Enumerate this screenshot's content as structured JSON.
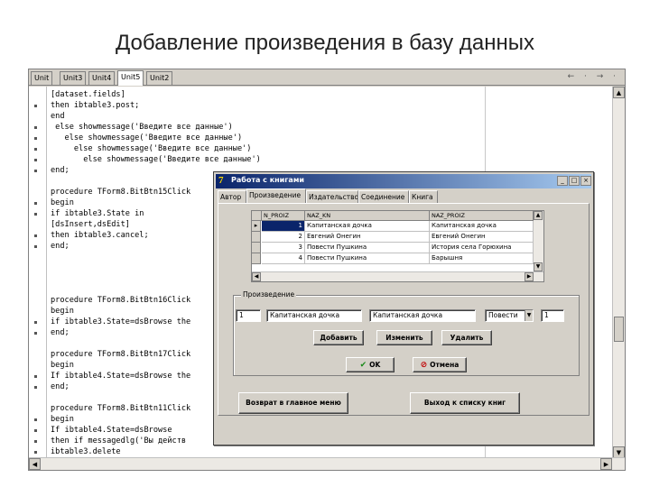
{
  "slide_title": "Добавление произведения в базу данных",
  "editor": {
    "tabs": [
      "Unit",
      "Unit3",
      "Unit4",
      "Unit5",
      "Unit2"
    ],
    "active_tab": 3,
    "nav_arrows": "← · → ·",
    "code_lines": [
      {
        "text": "[dataset.fields]",
        "dot": false
      },
      {
        "text": "then ibtable3.post;",
        "dot": true
      },
      {
        "text": "end",
        "dot": false
      },
      {
        "text": " else showmessage('Введите все данные')",
        "dot": true
      },
      {
        "text": "   else showmessage('Введите все данные')",
        "dot": true
      },
      {
        "text": "     else showmessage('Введите все данные')",
        "dot": true
      },
      {
        "text": "       else showmessage('Введите все данные')",
        "dot": true
      },
      {
        "text": "end;",
        "dot": true
      },
      {
        "text": "",
        "dot": false
      },
      {
        "text": "procedure TForm8.BitBtn15Click",
        "dot": false
      },
      {
        "text": "begin",
        "dot": true
      },
      {
        "text": "if ibtable3.State in",
        "dot": true
      },
      {
        "text": "[dsInsert,dsEdit]",
        "dot": false
      },
      {
        "text": "then ibtable3.cancel;",
        "dot": true
      },
      {
        "text": "end;",
        "dot": true
      },
      {
        "text": "",
        "dot": false
      },
      {
        "text": "",
        "dot": false
      },
      {
        "text": "",
        "dot": false
      },
      {
        "text": "",
        "dot": false
      },
      {
        "text": "procedure TForm8.BitBtn16Click",
        "dot": false
      },
      {
        "text": "begin",
        "dot": false
      },
      {
        "text": "if ibtable3.State=dsBrowse the",
        "dot": true
      },
      {
        "text": "end;",
        "dot": true
      },
      {
        "text": "",
        "dot": false
      },
      {
        "text": "procedure TForm8.BitBtn17Click",
        "dot": false
      },
      {
        "text": "begin",
        "dot": false
      },
      {
        "text": "If ibtable4.State=dsBrowse the",
        "dot": true
      },
      {
        "text": "end;",
        "dot": true
      },
      {
        "text": "",
        "dot": false
      },
      {
        "text": "procedure TForm8.BitBtn11Click",
        "dot": false
      },
      {
        "text": "begin",
        "dot": true
      },
      {
        "text": "If ibtable4.State=dsBrowse",
        "dot": true
      },
      {
        "text": "then if messagedlg('Вы действ",
        "dot": true
      },
      {
        "text": "ibtable3.delete",
        "dot": true
      }
    ]
  },
  "dialog": {
    "title": "Работа с книгами",
    "logo": "7",
    "window_buttons": [
      "_",
      "□",
      "×"
    ],
    "tabs": [
      "Автор",
      "Произведение",
      "Издательство",
      "Соединение",
      "Книга"
    ],
    "active_tab": 1,
    "grid": {
      "columns": [
        "N_PROIZ",
        "NAZ_KN",
        "NAZ_PROIZ"
      ],
      "rows": [
        {
          "n": "1",
          "naz_kn": "Капитанская дочка",
          "naz_proiz": "Капитанская дочка",
          "selected": true
        },
        {
          "n": "2",
          "naz_kn": "Евгений Онегин",
          "naz_proiz": "Евгений Онегин",
          "selected": false
        },
        {
          "n": "3",
          "naz_kn": "Повести Пушкина",
          "naz_proiz": "История села Горюхина",
          "selected": false
        },
        {
          "n": "4",
          "naz_kn": "Повести Пушкина",
          "naz_proiz": "Барышня",
          "selected": false
        }
      ]
    },
    "group_label": "Произведение",
    "fields": {
      "id_value": "1",
      "book_title": "Капитанская дочка",
      "work_title": "Капитанская дочка",
      "combo_value": "Повести",
      "num_value": "1"
    },
    "buttons": {
      "add": "Добавить",
      "edit": "Изменить",
      "delete": "Удалить",
      "ok": "OK",
      "cancel": "Отмена",
      "back_main": "Возврат в главное меню",
      "back_books": "Выход к списку книг"
    }
  }
}
